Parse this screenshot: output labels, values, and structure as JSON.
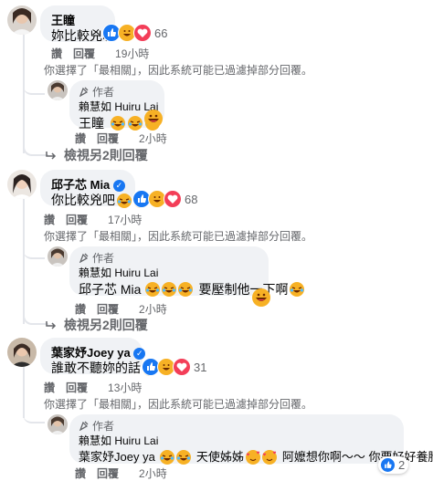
{
  "colors": {
    "like_blue": "#1877f2",
    "love_red": "#f33e58",
    "haha_yellow": "#f7b125",
    "bubble_bg": "#f0f2f5",
    "meta_gray": "#65676b"
  },
  "comments": [
    {
      "author": "王瞳",
      "text": "妳比較兇咖",
      "reaction_count": "66",
      "like_label": "讚",
      "reply_label": "回覆",
      "time": "19小時",
      "notice": "你選擇了「最相關」，因此系統可能已過濾掉部分回覆。",
      "reply": {
        "author_badge": "作者",
        "author": "賴慧如 Huiru Lai",
        "text": "王瞳",
        "like_label": "讚",
        "reply_label": "回覆",
        "time": "2小時"
      },
      "view_more": "檢視另2則回覆"
    },
    {
      "author": "邱子芯 Mia",
      "text": "你比較兇吧",
      "reaction_count": "68",
      "like_label": "讚",
      "reply_label": "回覆",
      "time": "17小時",
      "notice": "你選擇了「最相關」，因此系統可能已過濾掉部分回覆。",
      "reply": {
        "author_badge": "作者",
        "author": "賴慧如 Huiru Lai",
        "text_prefix": "邱子芯 Mia",
        "text_suffix": "要壓制他一下啊",
        "like_label": "讚",
        "reply_label": "回覆",
        "time": "2小時"
      },
      "view_more": "檢視另2則回覆"
    },
    {
      "author": "葉家妤Joey ya",
      "text": "誰敢不聽妳的話",
      "reaction_count": "31",
      "like_label": "讚",
      "reply_label": "回覆",
      "time": "13小時",
      "notice": "你選擇了「最相關」，因此系統可能已過濾掉部分回覆。",
      "reply": {
        "author_badge": "作者",
        "author": "賴慧如 Huiru Lai",
        "text_a": "葉家妤Joey ya",
        "text_b": "天使姊姊",
        "text_c": "阿嬤想你啊～～ 你要好好養胎歐",
        "like_label": "讚",
        "reply_label": "回覆",
        "time": "2小時",
        "reaction_count": "2"
      }
    }
  ],
  "icons": {
    "haha": "laughing-crying-emoji",
    "grin": "grinning-emoji",
    "sweat": "sweat-smile-emoji",
    "love_face": "smiling-hearts-emoji",
    "like": "like-reaction-icon",
    "love": "love-reaction-icon",
    "verified": "verified-badge-icon",
    "author": "author-badge-icon",
    "reply_arrow": "reply-arrow-icon"
  }
}
